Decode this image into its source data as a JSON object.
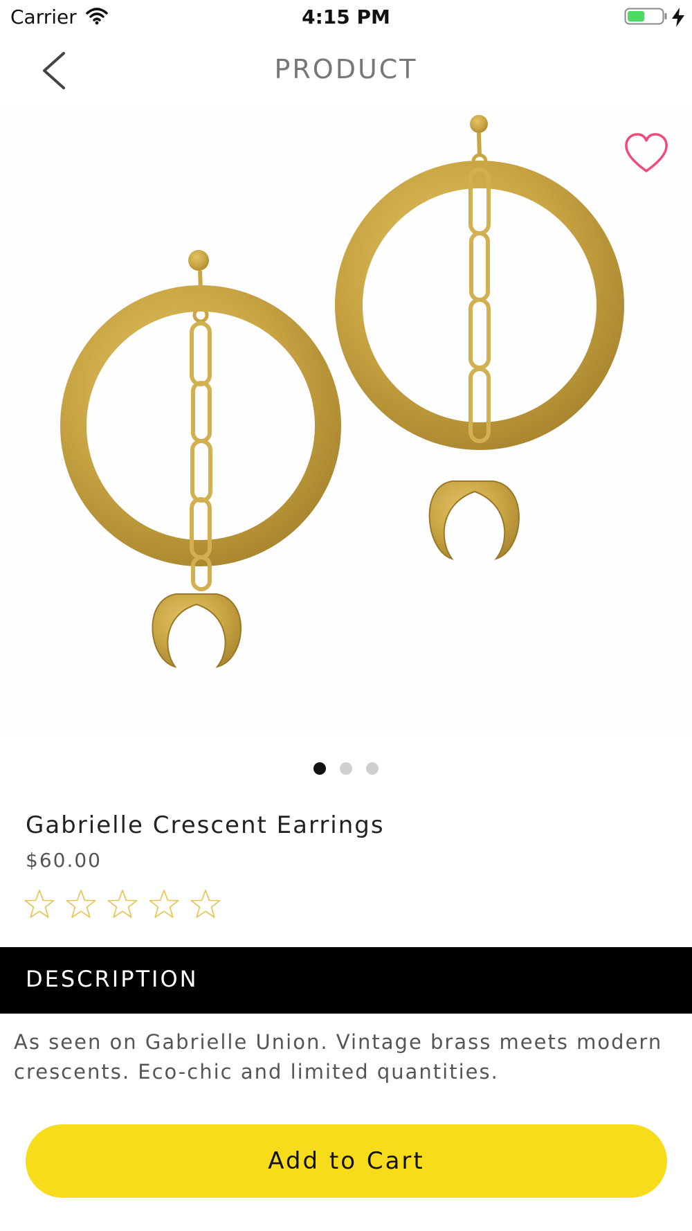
{
  "status_bar": {
    "carrier": "Carrier",
    "time": "4:15 PM"
  },
  "nav": {
    "title": "PRODUCT"
  },
  "gallery": {
    "page_count": 3,
    "active_page": 1
  },
  "product": {
    "name": "Gabrielle Crescent Earrings",
    "price": "$60.00",
    "rating": {
      "filled": 0,
      "max": 5
    }
  },
  "description": {
    "header": "DESCRIPTION",
    "text": "As seen on Gabrielle Union. Vintage brass meets modern crescents. Eco-chic and limited quantities."
  },
  "cart": {
    "button_label": "Add to Cart"
  },
  "colors": {
    "accent_yellow": "#f7dc1b",
    "heart_pink": "#f0497a",
    "star_outline": "#e6c65a",
    "brass_gold": "#c9a544",
    "description_bar": "#000000"
  },
  "icons": {
    "back": "chevron-left-icon",
    "favorite": "heart-outline-icon",
    "rating": "star-outline-icon",
    "wifi": "wifi-icon",
    "battery": "battery-charging-icon"
  }
}
